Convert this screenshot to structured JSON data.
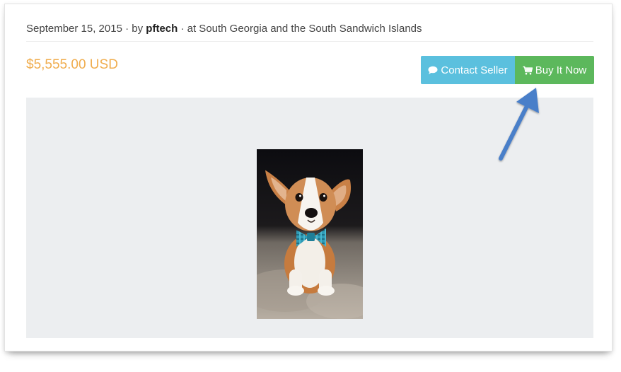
{
  "listing": {
    "date": "September 15, 2015",
    "by_prefix": "· by",
    "author": "pftech",
    "location_text": "· at South Georgia and the South Sandwich Islands",
    "price": "$5,555.00 USD"
  },
  "actions": {
    "contact_label": "Contact Seller",
    "contact_icon": "chat-bubble-icon",
    "buy_label": "Buy It Now",
    "buy_icon": "cart-icon"
  },
  "colors": {
    "price": "#f0ad4e",
    "contact_button": "#5bc0de",
    "buy_button": "#5cb85c",
    "gallery_background": "#eceef0",
    "annotation_arrow": "#4a7fc9"
  },
  "image": {
    "subject_icon": "corgi-puppy-photo"
  }
}
